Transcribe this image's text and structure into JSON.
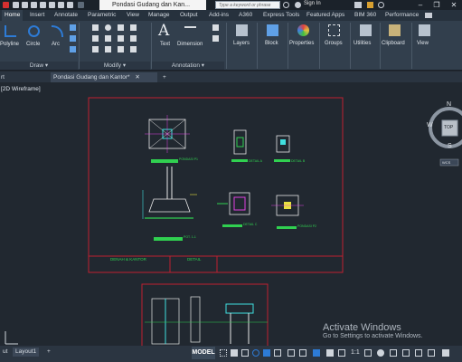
{
  "titlebar": {
    "doc_title": "Pondasi Gudang dan Kan...",
    "search_placeholder": "Type a keyword or phrase",
    "signin_label": "Sign In"
  },
  "ribbon_tabs": [
    "Home",
    "Insert",
    "Annotate",
    "Parametric",
    "View",
    "Manage",
    "Output",
    "Add-ins",
    "A360",
    "Express Tools",
    "Featured Apps",
    "BIM 360",
    "Performance"
  ],
  "ribbon": {
    "draw_tools": [
      "Polyline",
      "Circle",
      "Arc"
    ],
    "annotation_tools": [
      "Text",
      "Dimension"
    ],
    "big_buttons": [
      "Layers",
      "Block",
      "Properties",
      "Groups",
      "Utilities",
      "Clipboard",
      "View"
    ],
    "panel_titles": [
      "Draw",
      "Modify",
      "Annotation"
    ]
  },
  "doc_tabs": {
    "first_partial": "rt",
    "active": "Pondasi Gudang dan Kantor*",
    "add": "+"
  },
  "viewport": {
    "label": "[2D Wireframe]",
    "viewcube": {
      "n": "N",
      "s": "S",
      "e": "E",
      "w": "W",
      "top": "TOP",
      "wcs": "WCS"
    },
    "sheet_titles": [
      "DENAH & KANTOR",
      "DETAIL"
    ],
    "drawing_captions": [
      "PONDASI P1",
      "DETAIL A",
      "DETAIL B",
      "POT. 1-1",
      "PONDASI P2",
      "DETAIL C"
    ],
    "watermark_title": "Activate Windows",
    "watermark_sub": "Go to Settings to activate Windows."
  },
  "layout_tabs": [
    "ut",
    "Layout1",
    "+"
  ],
  "statusbar": {
    "model": "MODEL",
    "scale": "1:1"
  },
  "colors": {
    "accent_blue": "#2d7bd6",
    "sheet_border": "#c02030",
    "drawing_green": "#30d050",
    "drawing_cyan": "#40e0e0",
    "drawing_magenta": "#e040e0",
    "drawing_yellow": "#e8e040"
  }
}
